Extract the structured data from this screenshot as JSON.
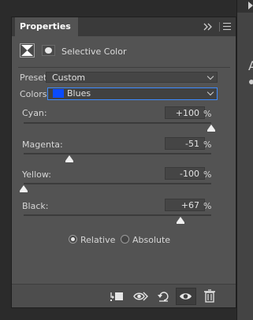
{
  "panel": {
    "tab_label": "Properties",
    "adjustment_title": "Selective Color"
  },
  "preset": {
    "label": "Preset:",
    "value": "Custom"
  },
  "colors": {
    "label": "Colors:",
    "value": "Blues",
    "swatch_color": "#0a4bff"
  },
  "sliders": [
    {
      "label": "Cyan:",
      "value": "+100",
      "unit": "%",
      "percent": 100
    },
    {
      "label": "Magenta:",
      "value": "-51",
      "unit": "%",
      "percent": -51
    },
    {
      "label": "Yellow:",
      "value": "-100",
      "unit": "%",
      "percent": -100
    },
    {
      "label": "Black:",
      "value": "+67",
      "unit": "%",
      "percent": 67
    }
  ],
  "method": {
    "relative_label": "Relative",
    "absolute_label": "Absolute",
    "selected": "relative"
  },
  "icons": {
    "adjustment": "selective-color-icon",
    "mask": "mask-icon",
    "clip": "clip-to-layer-icon",
    "view_previous": "view-previous-icon",
    "reset": "reset-icon",
    "visibility": "visibility-eye-icon",
    "delete": "trash-icon",
    "expand": "expand-panel-icon",
    "menu": "panel-menu-icon"
  },
  "right_panel": {
    "letter": "A"
  }
}
